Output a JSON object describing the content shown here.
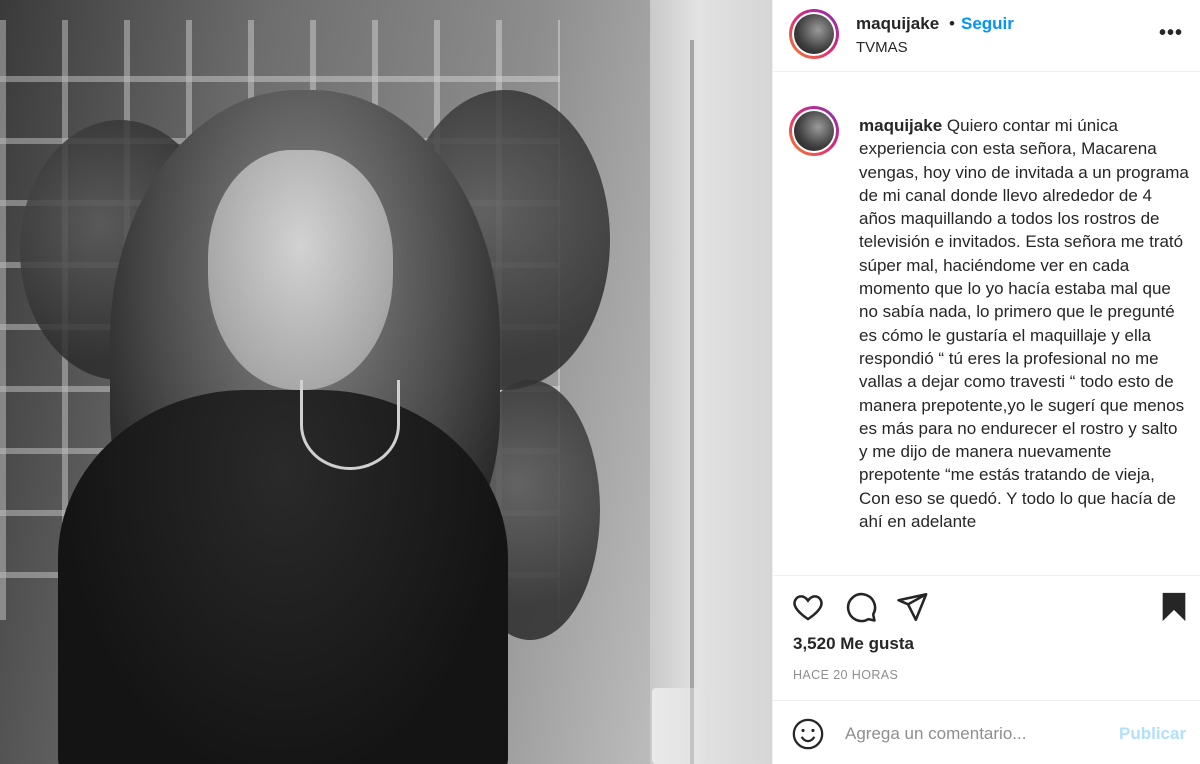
{
  "post": {
    "image_description_icon": "photo",
    "header": {
      "username": "maquijake",
      "separator": "•",
      "follow_label": "Seguir",
      "location": "TVMAS",
      "more_icon": "more-horizontal-icon",
      "more_label": "•••"
    },
    "caption": {
      "username": "maquijake",
      "text": "Quiero contar mi única experiencia con esta señora, Macarena vengas, hoy vino de invitada a un programa de mi canal donde llevo alrededor de 4 años maquillando a todos los rostros de televisión e invitados. Esta señora me trató súper mal, haciéndome ver en cada momento que lo yo hacía estaba mal que no sabía nada, lo primero que le pregunté es cómo le gustaría el maquillaje y ella respondió “ tú eres la profesional no me vallas a dejar como travesti “ todo esto de manera prepotente,yo le sugerí que menos es más para no endurecer el rostro y salto y me dijo de manera nuevamente prepotente “me estás tratando de vieja, Con eso se quedó. Y todo lo que hacía de ahí en adelante"
    },
    "actions": {
      "like_icon": "heart-icon",
      "comment_icon": "comment-bubble-icon",
      "share_icon": "paper-plane-icon",
      "save_icon": "bookmark-icon"
    },
    "likes_text": "3,520 Me gusta",
    "timestamp": "HACE 20 HORAS",
    "comment_box": {
      "emoji_icon": "smiley-icon",
      "placeholder": "Agrega un comentario...",
      "publish_label": "Publicar"
    },
    "colors": {
      "link_blue": "#0095f6",
      "publish_disabled": "#b2dffc",
      "text": "#262626",
      "muted": "#8e8e8e"
    }
  }
}
